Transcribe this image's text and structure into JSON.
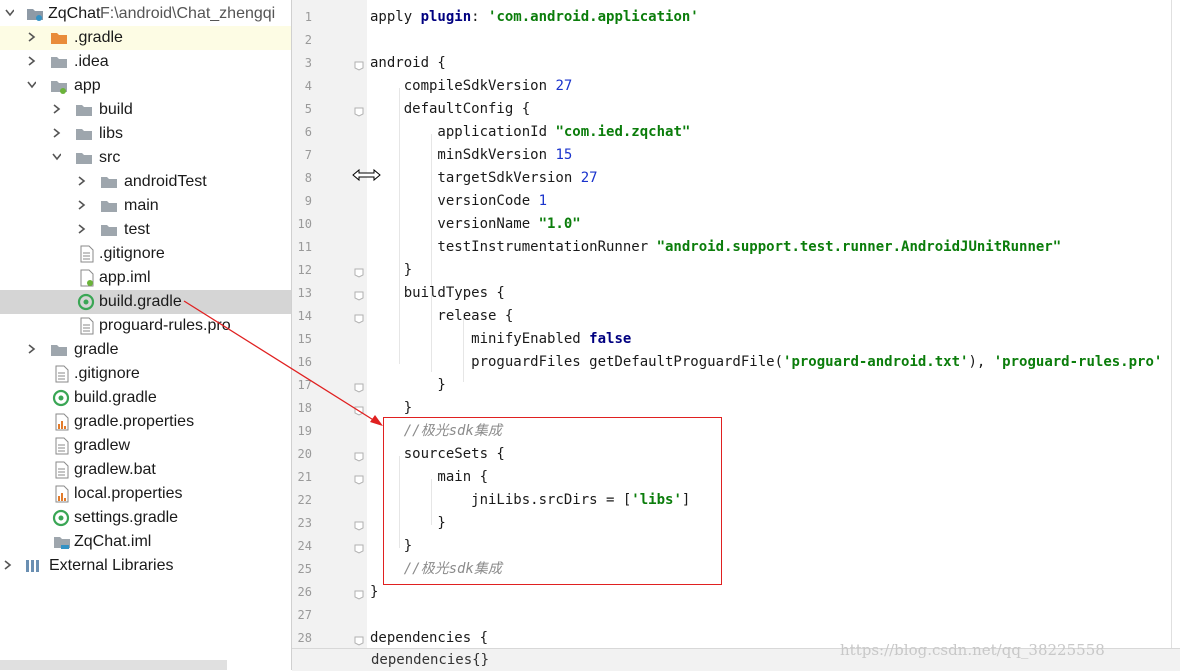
{
  "project": {
    "root_name": "ZqChat",
    "root_path": "F:\\android\\Chat_zhengqi",
    "tree": [
      {
        "label": "ZqChat",
        "icon": "module-folder-icon"
      },
      {
        "label": ".gradle",
        "icon": "orange-folder-icon"
      },
      {
        "label": ".idea",
        "icon": "folder-icon"
      },
      {
        "label": "app",
        "icon": "module-folder-icon"
      },
      {
        "label": "build",
        "icon": "folder-icon"
      },
      {
        "label": "libs",
        "icon": "folder-icon"
      },
      {
        "label": "src",
        "icon": "folder-icon"
      },
      {
        "label": "androidTest",
        "icon": "folder-icon"
      },
      {
        "label": "main",
        "icon": "folder-icon"
      },
      {
        "label": "test",
        "icon": "folder-icon"
      },
      {
        "label": ".gitignore",
        "icon": "text-file-icon"
      },
      {
        "label": "app.iml",
        "icon": "iml-file-icon"
      },
      {
        "label": "build.gradle",
        "icon": "gradle-file-icon"
      },
      {
        "label": "proguard-rules.pro",
        "icon": "text-file-icon"
      },
      {
        "label": "gradle",
        "icon": "folder-icon"
      },
      {
        "label": ".gitignore",
        "icon": "text-file-icon"
      },
      {
        "label": "build.gradle",
        "icon": "gradle-file-icon"
      },
      {
        "label": "gradle.properties",
        "icon": "properties-file-icon"
      },
      {
        "label": "gradlew",
        "icon": "text-file-icon"
      },
      {
        "label": "gradlew.bat",
        "icon": "text-file-icon"
      },
      {
        "label": "local.properties",
        "icon": "properties-file-icon"
      },
      {
        "label": "settings.gradle",
        "icon": "gradle-file-icon"
      },
      {
        "label": "ZqChat.iml",
        "icon": "iml-file-icon"
      },
      {
        "label": "External Libraries",
        "icon": "library-icon"
      }
    ]
  },
  "editor": {
    "line_numbers": [
      "1",
      "2",
      "3",
      "4",
      "5",
      "6",
      "7",
      "8",
      "9",
      "10",
      "11",
      "12",
      "13",
      "14",
      "15",
      "16",
      "17",
      "18",
      "19",
      "20",
      "21",
      "22",
      "23",
      "24",
      "25",
      "26",
      "27",
      "28"
    ],
    "lines": [
      [
        [
          "t",
          "apply "
        ],
        [
          "kw",
          "plugin"
        ],
        [
          "t",
          ": "
        ],
        [
          "str",
          "'com.android.application'"
        ]
      ],
      [],
      [
        [
          "t",
          "android {"
        ]
      ],
      [
        [
          "t",
          "    compileSdkVersion "
        ],
        [
          "num",
          "27"
        ]
      ],
      [
        [
          "t",
          "    defaultConfig {"
        ]
      ],
      [
        [
          "t",
          "        applicationId "
        ],
        [
          "str",
          "\"com.ied.zqchat\""
        ]
      ],
      [
        [
          "t",
          "        minSdkVersion "
        ],
        [
          "num",
          "15"
        ]
      ],
      [
        [
          "t",
          "        targetSdkVersion "
        ],
        [
          "num",
          "27"
        ]
      ],
      [
        [
          "t",
          "        versionCode "
        ],
        [
          "num",
          "1"
        ]
      ],
      [
        [
          "t",
          "        versionName "
        ],
        [
          "str",
          "\"1.0\""
        ]
      ],
      [
        [
          "t",
          "        testInstrumentationRunner "
        ],
        [
          "str",
          "\"android.support.test.runner.AndroidJUnitRunner\""
        ]
      ],
      [
        [
          "t",
          "    }"
        ]
      ],
      [
        [
          "t",
          "    buildTypes {"
        ]
      ],
      [
        [
          "t",
          "        release {"
        ]
      ],
      [
        [
          "t",
          "            minifyEnabled "
        ],
        [
          "kwb",
          "false"
        ]
      ],
      [
        [
          "t",
          "            proguardFiles getDefaultProguardFile("
        ],
        [
          "str",
          "'proguard-android.txt'"
        ],
        [
          "t",
          "), "
        ],
        [
          "str",
          "'proguard-rules.pro'"
        ]
      ],
      [
        [
          "t",
          "        }"
        ]
      ],
      [
        [
          "t",
          "    }"
        ]
      ],
      [
        [
          "t",
          "    "
        ],
        [
          "cmt",
          "//极光sdk集成"
        ]
      ],
      [
        [
          "t",
          "    sourceSets {"
        ]
      ],
      [
        [
          "t",
          "        main {"
        ]
      ],
      [
        [
          "t",
          "            jniLibs.srcDirs = ["
        ],
        [
          "str",
          "'libs'"
        ],
        [
          "t",
          "]"
        ]
      ],
      [
        [
          "t",
          "        }"
        ]
      ],
      [
        [
          "t",
          "    }"
        ]
      ],
      [
        [
          "t",
          "    "
        ],
        [
          "cmt",
          "//极光sdk集成"
        ]
      ],
      [
        [
          "t",
          "}"
        ]
      ],
      [],
      [
        [
          "t",
          "dependencies {"
        ]
      ]
    ],
    "breadcrumb": "dependencies{}",
    "watermark": "https://blog.csdn.net/qq_38225558"
  },
  "colors": {
    "annotation_red": "#e02020",
    "selection_gray": "#d5d5d5",
    "string_green": "#0b7d0b",
    "number_blue": "#1a33cc",
    "keyword_navy": "#000080"
  }
}
